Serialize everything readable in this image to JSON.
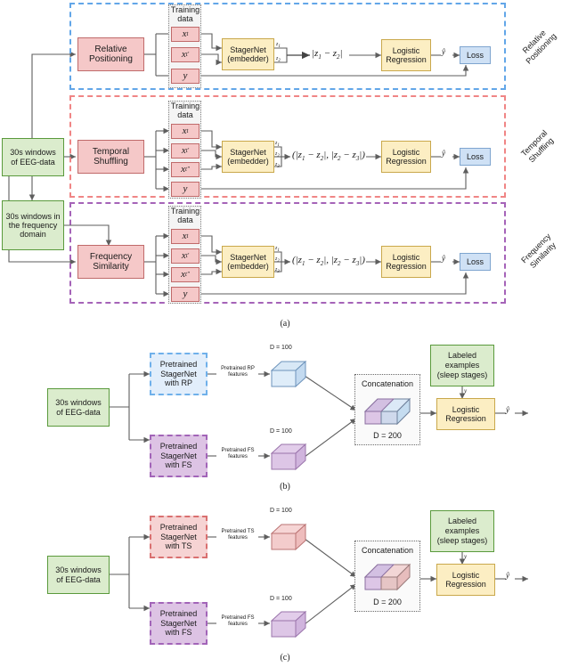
{
  "figure": {
    "panel_a_label": "(a)",
    "panel_b_label": "(b)",
    "panel_c_label": "(c)"
  },
  "colors": {
    "green": "#dbeccd",
    "pink": "#f5c8c8",
    "yellow": "#fceec3",
    "blue": "#cfe1f5",
    "lilac": "#ddc3e4",
    "dash_blue": "#62a6e8",
    "dash_red": "#f08585",
    "dash_purple": "#a563b8"
  },
  "panel_a": {
    "inputs": {
      "eeg": "30s windows\nof EEG-data",
      "eeg_l1": "30s windows",
      "eeg_l2": "of EEG-data",
      "freq_l1": "30s windows in",
      "freq_l2": "the frequency",
      "freq_l3": "domain"
    },
    "rows": [
      {
        "id": "rp",
        "task_l1": "Relative",
        "task_l2": "Positioning",
        "side_l1": "Relative",
        "side_l2": "Positioning",
        "training_l1": "Training",
        "training_l2": "data",
        "samples": [
          "x_t",
          "x_t'"
        ],
        "label_var": "y",
        "stagernet_l1": "StagerNet",
        "stagernet_l2": "(embedder)",
        "z_labels": [
          "z1",
          "z2"
        ],
        "combine": "|z1 − z2|",
        "classifier_l1": "Logistic",
        "classifier_l2": "Regression",
        "pred": "ŷ",
        "loss": "Loss"
      },
      {
        "id": "ts",
        "task_l1": "Temporal",
        "task_l2": "Shuffling",
        "side_l1": "Temporal",
        "side_l2": "Shuffling",
        "training_l1": "Training",
        "training_l2": "data",
        "samples": [
          "x_t",
          "x_t'",
          "x_t''"
        ],
        "label_var": "y",
        "stagernet_l1": "StagerNet",
        "stagernet_l2": "(embedder)",
        "z_labels": [
          "z1",
          "z2",
          "z3"
        ],
        "combine": "(|z1 − z2|, |z2 − z3|)",
        "classifier_l1": "Logistic",
        "classifier_l2": "Regression",
        "pred": "ŷ",
        "loss": "Loss"
      },
      {
        "id": "fs",
        "task_l1": "Frequency",
        "task_l2": "Similarity",
        "side_l1": "Frequency",
        "side_l2": "Similarity",
        "training_l1": "Training",
        "training_l2": "data",
        "samples": [
          "x_t",
          "x_t'",
          "x_t''"
        ],
        "label_var": "y",
        "stagernet_l1": "StagerNet",
        "stagernet_l2": "(embedder)",
        "z_labels": [
          "z1",
          "z2",
          "z3"
        ],
        "combine": "(|z1 − z2|, |z2 − z3|)",
        "classifier_l1": "Logistic",
        "classifier_l2": "Regression",
        "pred": "ŷ",
        "loss": "Loss"
      }
    ]
  },
  "panel_b": {
    "input_l1": "30s windows",
    "input_l2": "of EEG-data",
    "branch_top": {
      "l1": "Pretrained",
      "l2": "StagerNet",
      "l3": "with RP",
      "feat_l1": "Pretrained RP",
      "feat_l2": "features",
      "dim": "D = 100"
    },
    "branch_bottom": {
      "l1": "Pretrained",
      "l2": "StagerNet",
      "l3": "with FS",
      "feat_l1": "Pretrained FS",
      "feat_l2": "features",
      "dim": "D = 100"
    },
    "concat_title": "Concatenation",
    "concat_dim": "D = 200",
    "labeled_l1": "Labeled",
    "labeled_l2": "examples",
    "labeled_l3": "(sleep stages)",
    "label_var": "y",
    "classifier_l1": "Logistic",
    "classifier_l2": "Regression",
    "pred": "ŷ"
  },
  "panel_c": {
    "input_l1": "30s windows",
    "input_l2": "of EEG-data",
    "branch_top": {
      "l1": "Pretrained",
      "l2": "StagerNet",
      "l3": "with TS",
      "feat_l1": "Pretrained TS",
      "feat_l2": "features",
      "dim": "D = 100"
    },
    "branch_bottom": {
      "l1": "Pretrained",
      "l2": "StagerNet",
      "l3": "with FS",
      "feat_l1": "Pretrained FS",
      "feat_l2": "features",
      "dim": "D = 100"
    },
    "concat_title": "Concatenation",
    "concat_dim": "D = 200",
    "labeled_l1": "Labeled",
    "labeled_l2": "examples",
    "labeled_l3": "(sleep stages)",
    "label_var": "y",
    "classifier_l1": "Logistic",
    "classifier_l2": "Regression",
    "pred": "ŷ"
  }
}
